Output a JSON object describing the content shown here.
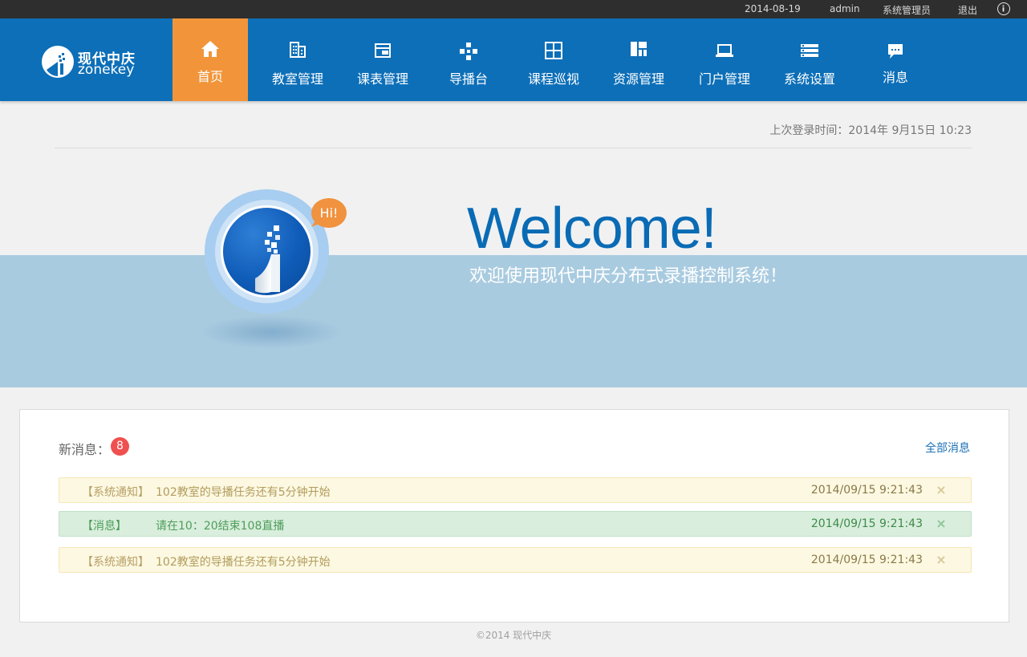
{
  "topbar": {
    "date": "2014-08-19",
    "user": "admin",
    "role": "系统管理员",
    "logout": "退出",
    "info_icon": "info-icon"
  },
  "logo": {
    "cn": "现代中庆",
    "en": "zonekey"
  },
  "nav": {
    "items": [
      {
        "label": "首页",
        "icon": "home-icon",
        "active": true
      },
      {
        "label": "教室管理",
        "icon": "building-icon"
      },
      {
        "label": "课表管理",
        "icon": "schedule-icon"
      },
      {
        "label": "导播台",
        "icon": "gamepad-icon"
      },
      {
        "label": "课程巡视",
        "icon": "grid-icon"
      },
      {
        "label": "资源管理",
        "icon": "layout-icon"
      },
      {
        "label": "门户管理",
        "icon": "laptop-icon"
      },
      {
        "label": "系统设置",
        "icon": "list-icon"
      },
      {
        "label": "消息",
        "icon": "chat-icon"
      }
    ]
  },
  "last_login": "上次登录时间：2014年 9月15日  10:23",
  "banner": {
    "hi": "Hi!",
    "welcome": "Welcome!",
    "subtitle": "欢迎使用现代中庆分布式录播控制系统！"
  },
  "messages": {
    "title": "新消息：",
    "count": "8",
    "all_link": "全部消息",
    "items": [
      {
        "tag": "【系统通知】",
        "text": "102教室的导播任务还有5分钟开始",
        "time": "2014/09/15 9:21:43",
        "type": "warn"
      },
      {
        "tag": "【消息】",
        "text": "请在10：20结束108直播",
        "time": "2014/09/15 9:21:43",
        "type": "ok"
      },
      {
        "tag": "【系统通知】",
        "text": "102教室的导播任务还有5分钟开始",
        "time": "2014/09/15 9:21:43",
        "type": "warn"
      }
    ],
    "close_glyph": "×"
  },
  "footer": "©2014 现代中庆",
  "colors": {
    "nav_bg": "#0d6fb8",
    "active_tab": "#f2953a",
    "topbar_bg": "#2e2e2e",
    "badge": "#f05050",
    "welcome": "#0a6bb5"
  }
}
